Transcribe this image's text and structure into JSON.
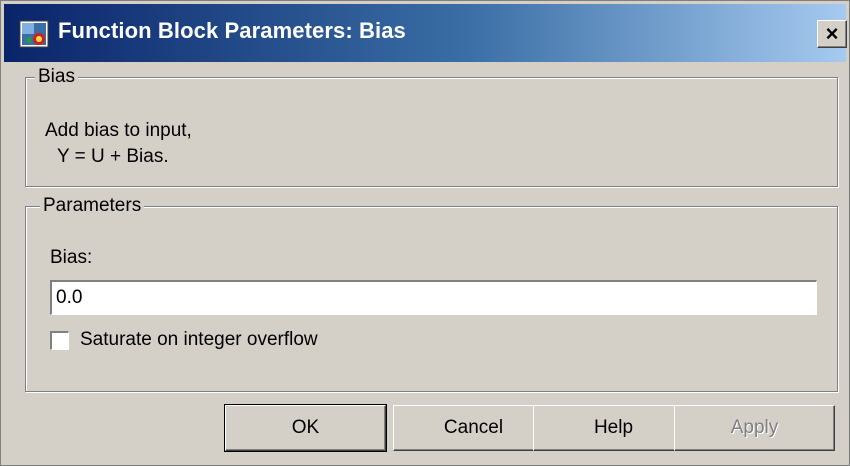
{
  "window": {
    "title": "Function Block Parameters: Bias",
    "close_label": "×"
  },
  "description": {
    "group_title": "Bias",
    "lines": [
      "Add bias to input,",
      "Y = U + Bias."
    ]
  },
  "parameters": {
    "group_title": "Parameters",
    "bias_label": "Bias:",
    "bias_value": "0.0",
    "saturate_label": "Saturate on integer overflow",
    "saturate_checked": false
  },
  "buttons": {
    "ok": "OK",
    "cancel": "Cancel",
    "help": "Help",
    "apply": "Apply"
  },
  "colors": {
    "titlebar_start": "#0a246a",
    "titlebar_end": "#a6caf0",
    "dialog_face": "#d4d0c8"
  },
  "icons": {
    "title": "simulink-block-icon",
    "close": "close-icon"
  }
}
